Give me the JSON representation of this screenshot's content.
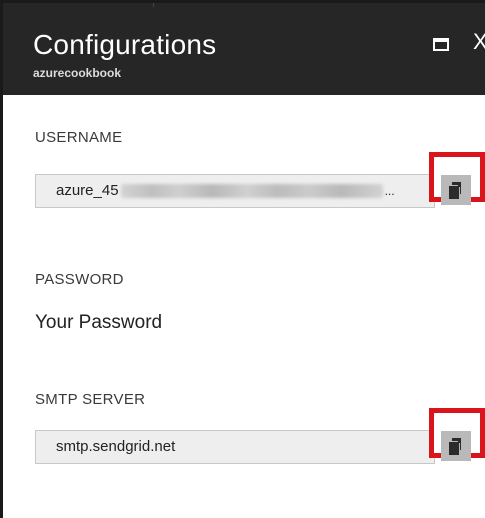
{
  "blade": {
    "title": "Configurations",
    "subtitle": "azurecookbook"
  },
  "header_controls": {
    "maximize_icon": "maximize-icon",
    "close_icon": "close-icon",
    "close_glyph": "X"
  },
  "fields": {
    "username": {
      "label": "USERNAME",
      "value_visible": "azure_45",
      "value_redacted": true,
      "truncation": "...",
      "copy_icon": "copy-icon"
    },
    "password": {
      "label": "PASSWORD",
      "value": "Your Password"
    },
    "smtp_server": {
      "label": "SMTP SERVER",
      "value": "smtp.sendgrid.net",
      "copy_icon": "copy-icon"
    }
  },
  "colors": {
    "header_bg": "#262626",
    "highlight": "#d9141b",
    "field_bg": "#eeeeee",
    "copy_button_bg": "#b9b9b9"
  }
}
